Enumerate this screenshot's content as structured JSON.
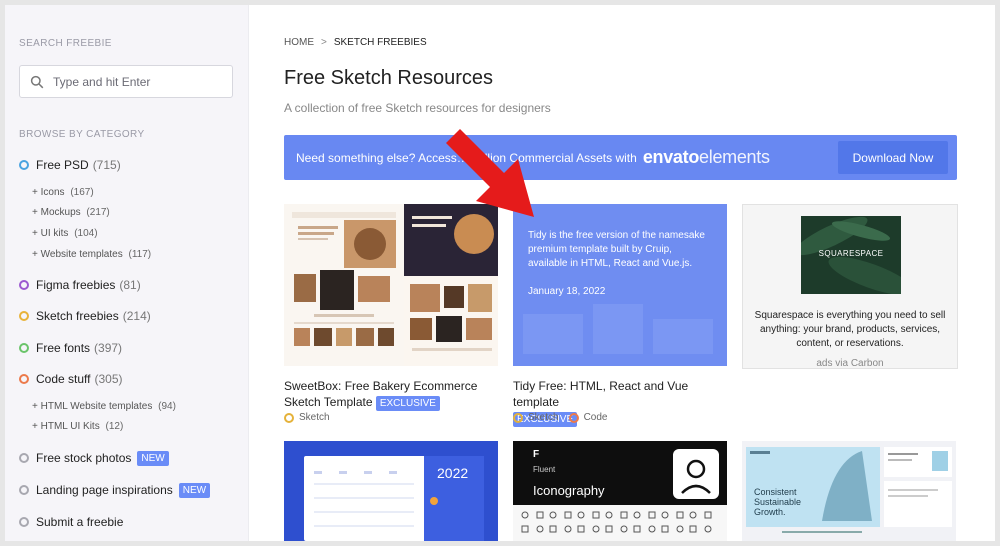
{
  "sidebar": {
    "search_heading": "SEARCH FREEBIE",
    "search_placeholder": "Type and hit Enter",
    "browse_heading": "BROWSE BY CATEGORY",
    "categories": [
      {
        "label": "Free PSD",
        "count": "(715)",
        "color": "#4aa3e0"
      },
      {
        "label": "Figma freebies",
        "count": "(81)",
        "color": "#9b59d0"
      },
      {
        "label": "Sketch freebies",
        "count": "(214)",
        "color": "#e8b33a"
      },
      {
        "label": "Free fonts",
        "count": "(397)",
        "color": "#6ac46a"
      },
      {
        "label": "Code stuff",
        "count": "(305)",
        "color": "#ec7a4b"
      },
      {
        "label": "Free stock photos",
        "badge": "NEW",
        "color": "#a8a8b0"
      },
      {
        "label": "Landing page inspirations",
        "badge": "NEW",
        "color": "#a8a8b0"
      },
      {
        "label": "Submit a freebie",
        "color": "#a8a8b0"
      }
    ],
    "psd_subs": [
      {
        "label": "+ Icons",
        "count": "(167)"
      },
      {
        "label": "+ Mockups",
        "count": "(217)"
      },
      {
        "label": "+ UI kits",
        "count": "(104)"
      },
      {
        "label": "+ Website templates",
        "count": "(117)"
      }
    ],
    "code_subs": [
      {
        "label": "+ HTML Website templates",
        "count": "(94)"
      },
      {
        "label": "+ HTML UI Kits",
        "count": "(12)"
      }
    ]
  },
  "breadcrumb": {
    "home": "HOME",
    "sep": ">",
    "current": "SKETCH FREEBIES"
  },
  "page": {
    "title": "Free Sketch Resources",
    "subtitle": "A collection of free Sketch resources for designers"
  },
  "banner": {
    "text": "Need something else? Access… Million Commercial Assets with",
    "logo_bold": "envato",
    "logo_light": "elements",
    "button": "Download Now"
  },
  "cards": [
    {
      "title": "SweetBox: Free Bakery Ecommerce Sketch Template",
      "badge": "EXCLUSIVE",
      "tags": [
        "Sketch"
      ]
    },
    {
      "title": "Tidy Free: HTML, React and Vue template",
      "badge": "EXCLUSIVE",
      "tags": [
        "Sketch",
        "Code"
      ],
      "thumb_text": "Tidy is the free version of the namesake premium template built by Cruip, available in HTML, React and Vue.js.",
      "thumb_date": "January 18, 2022"
    }
  ],
  "ad": {
    "logo": "SQUARESPACE",
    "text": "Squarespace is everything you need to sell anything: your brand, products, services, content, or reservations.",
    "via": "ads via Carbon"
  },
  "bottom_thumbs": {
    "calendar_year": "2022",
    "iconography_small": "Fluent",
    "iconography_title": "Iconography",
    "landing_headline": "Consistent Sustainable Growth."
  },
  "colors": {
    "accent": "#6888f2",
    "sketch_tag": "#e5b23a",
    "code_tag": "#ec7a4b",
    "arrow": "#e51b1b"
  }
}
